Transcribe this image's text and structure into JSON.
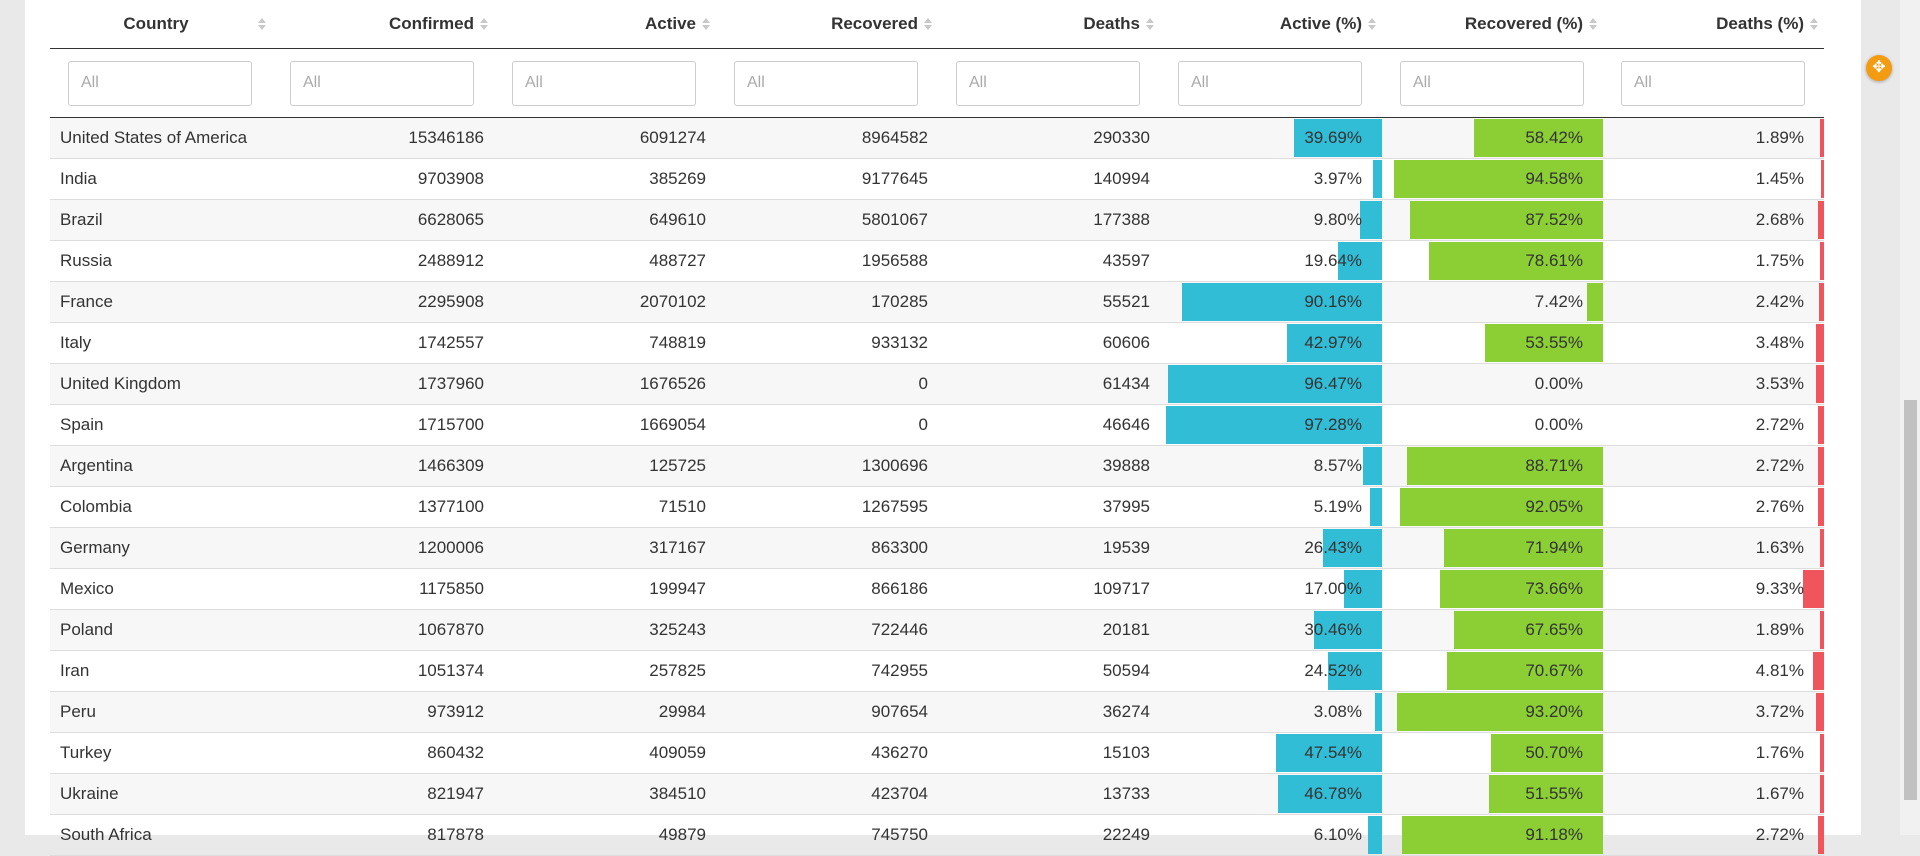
{
  "table": {
    "columns": [
      "Country",
      "Confirmed",
      "Active",
      "Recovered",
      "Deaths",
      "Active (%)",
      "Recovered (%)",
      "Deaths (%)"
    ],
    "filter_placeholder": "All",
    "rows": [
      {
        "country": "United States of America",
        "confirmed": "15346186",
        "active": "6091274",
        "recovered": "8964582",
        "deaths": "290330",
        "active_pct": "39.69%",
        "recovered_pct": "58.42%",
        "deaths_pct": "1.89%"
      },
      {
        "country": "India",
        "confirmed": "9703908",
        "active": "385269",
        "recovered": "9177645",
        "deaths": "140994",
        "active_pct": "3.97%",
        "recovered_pct": "94.58%",
        "deaths_pct": "1.45%"
      },
      {
        "country": "Brazil",
        "confirmed": "6628065",
        "active": "649610",
        "recovered": "5801067",
        "deaths": "177388",
        "active_pct": "9.80%",
        "recovered_pct": "87.52%",
        "deaths_pct": "2.68%"
      },
      {
        "country": "Russia",
        "confirmed": "2488912",
        "active": "488727",
        "recovered": "1956588",
        "deaths": "43597",
        "active_pct": "19.64%",
        "recovered_pct": "78.61%",
        "deaths_pct": "1.75%"
      },
      {
        "country": "France",
        "confirmed": "2295908",
        "active": "2070102",
        "recovered": "170285",
        "deaths": "55521",
        "active_pct": "90.16%",
        "recovered_pct": "7.42%",
        "deaths_pct": "2.42%"
      },
      {
        "country": "Italy",
        "confirmed": "1742557",
        "active": "748819",
        "recovered": "933132",
        "deaths": "60606",
        "active_pct": "42.97%",
        "recovered_pct": "53.55%",
        "deaths_pct": "3.48%"
      },
      {
        "country": "United Kingdom",
        "confirmed": "1737960",
        "active": "1676526",
        "recovered": "0",
        "deaths": "61434",
        "active_pct": "96.47%",
        "recovered_pct": "0.00%",
        "deaths_pct": "3.53%"
      },
      {
        "country": "Spain",
        "confirmed": "1715700",
        "active": "1669054",
        "recovered": "0",
        "deaths": "46646",
        "active_pct": "97.28%",
        "recovered_pct": "0.00%",
        "deaths_pct": "2.72%"
      },
      {
        "country": "Argentina",
        "confirmed": "1466309",
        "active": "125725",
        "recovered": "1300696",
        "deaths": "39888",
        "active_pct": "8.57%",
        "recovered_pct": "88.71%",
        "deaths_pct": "2.72%"
      },
      {
        "country": "Colombia",
        "confirmed": "1377100",
        "active": "71510",
        "recovered": "1267595",
        "deaths": "37995",
        "active_pct": "5.19%",
        "recovered_pct": "92.05%",
        "deaths_pct": "2.76%"
      },
      {
        "country": "Germany",
        "confirmed": "1200006",
        "active": "317167",
        "recovered": "863300",
        "deaths": "19539",
        "active_pct": "26.43%",
        "recovered_pct": "71.94%",
        "deaths_pct": "1.63%"
      },
      {
        "country": "Mexico",
        "confirmed": "1175850",
        "active": "199947",
        "recovered": "866186",
        "deaths": "109717",
        "active_pct": "17.00%",
        "recovered_pct": "73.66%",
        "deaths_pct": "9.33%"
      },
      {
        "country": "Poland",
        "confirmed": "1067870",
        "active": "325243",
        "recovered": "722446",
        "deaths": "20181",
        "active_pct": "30.46%",
        "recovered_pct": "67.65%",
        "deaths_pct": "1.89%"
      },
      {
        "country": "Iran",
        "confirmed": "1051374",
        "active": "257825",
        "recovered": "742955",
        "deaths": "50594",
        "active_pct": "24.52%",
        "recovered_pct": "70.67%",
        "deaths_pct": "4.81%"
      },
      {
        "country": "Peru",
        "confirmed": "973912",
        "active": "29984",
        "recovered": "907654",
        "deaths": "36274",
        "active_pct": "3.08%",
        "recovered_pct": "93.20%",
        "deaths_pct": "3.72%"
      },
      {
        "country": "Turkey",
        "confirmed": "860432",
        "active": "409059",
        "recovered": "436270",
        "deaths": "15103",
        "active_pct": "47.54%",
        "recovered_pct": "50.70%",
        "deaths_pct": "1.76%"
      },
      {
        "country": "Ukraine",
        "confirmed": "821947",
        "active": "384510",
        "recovered": "423704",
        "deaths": "13733",
        "active_pct": "46.78%",
        "recovered_pct": "51.55%",
        "deaths_pct": "1.67%"
      },
      {
        "country": "South Africa",
        "confirmed": "817878",
        "active": "49879",
        "recovered": "745750",
        "deaths": "22249",
        "active_pct": "6.10%",
        "recovered_pct": "91.18%",
        "deaths_pct": "2.72%"
      }
    ]
  },
  "colors": {
    "active_bar": "#31bdd6",
    "recovered_bar": "#8ccf34",
    "deaths_bar": "#f0545c",
    "fab": "#f39c12"
  },
  "icons": {
    "sort": "sort-icon",
    "fab": "expand-icon"
  }
}
